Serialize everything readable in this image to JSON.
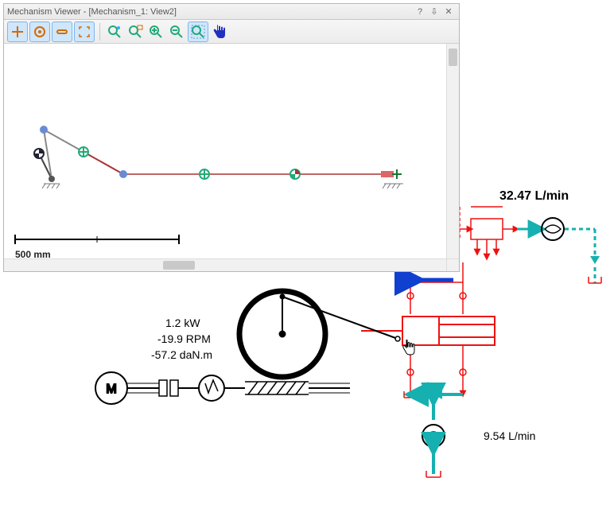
{
  "window": {
    "title": "Mechanism Viewer - [Mechanism_1: View2]",
    "help": "?",
    "pin": "⇩",
    "close": "✕"
  },
  "toolbar": {
    "tools": [
      {
        "name": "add-joint",
        "selected": true,
        "svg": "plus-target"
      },
      {
        "name": "pivot-joint",
        "selected": true,
        "svg": "circle-cross"
      },
      {
        "name": "link-tool",
        "selected": true,
        "svg": "h-link"
      },
      {
        "name": "fit-view",
        "selected": true,
        "svg": "fit-view"
      },
      {
        "sep": true
      },
      {
        "name": "zoom-window",
        "selected": false,
        "svg": "zoom-box"
      },
      {
        "name": "zoom-fit",
        "selected": false,
        "svg": "zoom-fit"
      },
      {
        "name": "zoom-in",
        "selected": false,
        "svg": "zoom-in"
      },
      {
        "name": "zoom-out",
        "selected": false,
        "svg": "zoom-out"
      },
      {
        "name": "zoom-region",
        "selected": true,
        "svg": "zoom-region"
      },
      {
        "name": "pan",
        "selected": false,
        "svg": "hand"
      }
    ]
  },
  "scale": {
    "label": "500 mm"
  },
  "readouts": {
    "power": "1.2 kW",
    "speed": "-19.9 RPM",
    "torque": "-57.2 daN.m",
    "flow_top": "32.47 L/min",
    "flow_bot": "9.54 L/min"
  },
  "colors": {
    "panel_border": "#b7b7b7",
    "hydraulic": "#e11",
    "hydraulic_dashed": "#e11",
    "flow": "#16b0b0",
    "flow_blue": "#1040d0"
  }
}
